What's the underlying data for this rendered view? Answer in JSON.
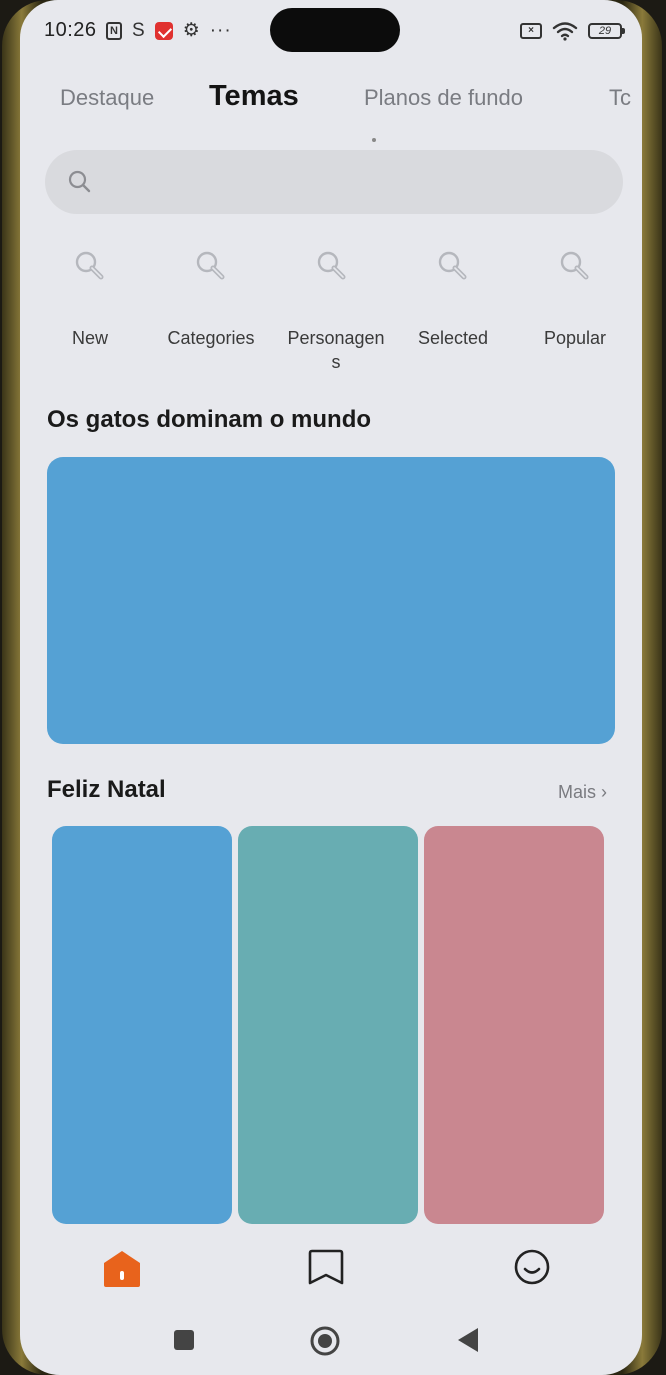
{
  "status_bar": {
    "time": "10:26",
    "nfc_label": "N",
    "s_label": "S",
    "gear": "⚙",
    "more": "···",
    "sim_label": "×",
    "battery": "29"
  },
  "tabs": [
    {
      "label": "Destaque"
    },
    {
      "label": "Temas"
    },
    {
      "label": "Planos de fundo"
    },
    {
      "label": "Tc"
    }
  ],
  "search": {
    "placeholder": ""
  },
  "categories": [
    {
      "label": "New",
      "icon": "magnifier-icon"
    },
    {
      "label": "Categories",
      "icon": "magnifier-icon"
    },
    {
      "label": "Personagens",
      "icon": "magnifier-icon"
    },
    {
      "label": "Selected",
      "icon": "magnifier-icon"
    },
    {
      "label": "Popular",
      "icon": "magnifier-icon"
    }
  ],
  "section1": {
    "title": "Os gatos dominam o mundo",
    "banner_color": "#55a1d4"
  },
  "section2": {
    "title": "Feliz Natal",
    "more": "Mais ›",
    "cards": [
      {
        "color": "#55a1d4"
      },
      {
        "color": "#68adb2"
      },
      {
        "color": "#c98790"
      }
    ]
  },
  "bottom_nav": [
    {
      "icon": "home-icon",
      "active": true
    },
    {
      "icon": "bookmark-icon",
      "active": false
    },
    {
      "icon": "smiley-icon",
      "active": false
    }
  ],
  "colors": {
    "accent": "#e8631c",
    "background": "#e7e8ed"
  }
}
